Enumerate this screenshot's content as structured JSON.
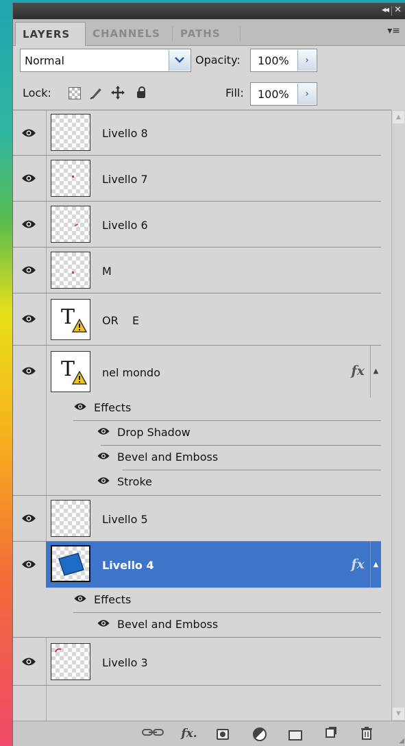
{
  "panel": {
    "title_controls": {
      "collapse": "◂◂",
      "close": "✕"
    },
    "tabs": [
      {
        "label": "LAYERS",
        "active": true
      },
      {
        "label": "CHANNELS",
        "active": false
      },
      {
        "label": "PATHS",
        "active": false
      }
    ],
    "menu_icon": "panel-menu-icon"
  },
  "controls": {
    "blend_mode": "Normal",
    "opacity_label": "Opacity:",
    "opacity_value": "100%",
    "lock_label": "Lock:",
    "fill_label": "Fill:",
    "fill_value": "100%",
    "arrow": "›",
    "dropdown_arrow": "⌄"
  },
  "layers": [
    {
      "name": "Livello 8",
      "kind": "raster",
      "visible": true
    },
    {
      "name": "Livello 7",
      "kind": "raster",
      "visible": true
    },
    {
      "name": "Livello 6",
      "kind": "raster",
      "visible": true
    },
    {
      "name": "M",
      "kind": "raster",
      "visible": true
    },
    {
      "name": "OR    E",
      "kind": "text",
      "visible": true
    },
    {
      "name": "nel mondo",
      "kind": "text",
      "visible": true,
      "fx": "fx",
      "effects_label": "Effects",
      "effects": [
        "Drop Shadow",
        "Bevel and Emboss",
        "Stroke"
      ]
    },
    {
      "name": "Livello 5",
      "kind": "raster",
      "visible": true
    },
    {
      "name": "Livello 4",
      "kind": "raster",
      "visible": true,
      "selected": true,
      "fx": "fx",
      "effects_label": "Effects",
      "effects": [
        "Bevel and Emboss"
      ]
    },
    {
      "name": "Livello 3",
      "kind": "raster",
      "visible": true
    }
  ],
  "bottom_toolbar": {
    "fx_label": "fx",
    "icons": [
      "link-layers-icon",
      "add-layer-style-icon",
      "add-mask-icon",
      "adjustment-layer-icon",
      "new-group-icon",
      "new-layer-icon",
      "delete-layer-icon"
    ]
  },
  "colors": {
    "selection": "#3e75c8",
    "panel": "#d6d6d6"
  }
}
